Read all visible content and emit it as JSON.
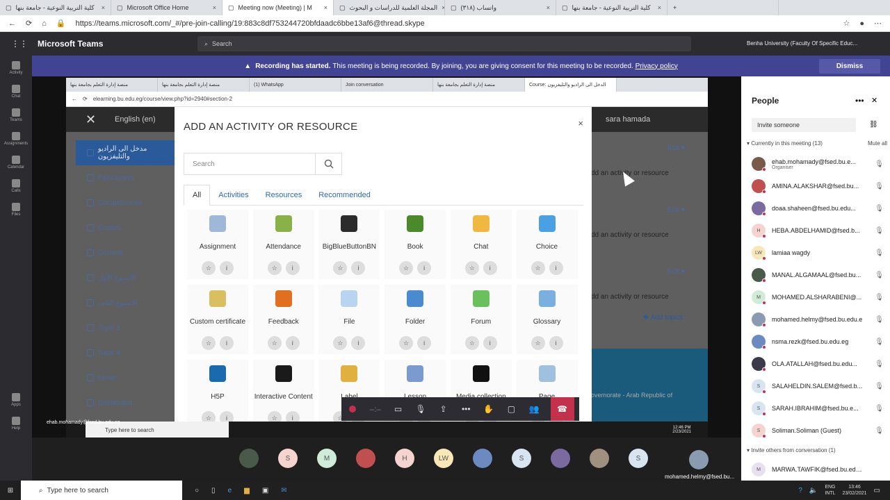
{
  "browser": {
    "tabs": [
      {
        "label": "كلية التربية النوعية - جامعة بنها",
        "active": false
      },
      {
        "label": "Microsoft Office Home",
        "active": false
      },
      {
        "label": "Meeting now (Meeting) | M",
        "active": true
      },
      {
        "label": "المجلة العلمية للدراسات و البحوث",
        "active": false
      },
      {
        "label": "(٣١٨) واتساب",
        "active": false
      },
      {
        "label": "كلية التربية النوعية - جامعة بنها",
        "active": false
      }
    ],
    "url": "https://teams.microsoft.com/_#/pre-join-calling/19:883c8df753244720bfdaadc6bbe13af6@thread.skype"
  },
  "teams": {
    "title": "Microsoft Teams",
    "search_placeholder": "Search",
    "org": "Benha University (Faculty Of Specific Educ...",
    "rail": [
      "Activity",
      "Chat",
      "Teams",
      "Assignments",
      "Calendar",
      "Calls",
      "Files",
      "Apps",
      "Help"
    ],
    "banner": {
      "bold": "Recording has started.",
      "text": "This meeting is being recorded. By joining, you are giving consent for this meeting to be recorded.",
      "link": "Privacy policy",
      "dismiss": "Dismiss"
    }
  },
  "shared": {
    "tabs": [
      "منصة إدارة التعلم بجامعة بنها",
      "منصة إدارة التعلم بجامعة بنها",
      "(1) WhatsApp",
      "Join conversation",
      "منصة إدارة التعلم بجامعة بنها",
      "Course: الدخل الى الراديو والتليفزيون"
    ],
    "url": "elearning.bu.edu.eg/course/view.php?id=2940#section-2",
    "lang": "English (en)",
    "user": "sara hamada",
    "sidebar": [
      "مدخل الى الراديو والتليفزيون",
      "Participants",
      "Competencies",
      "Grades",
      "General",
      "الأسبوع الأول",
      "الأسبوع الثاني",
      "Topic 3",
      "Topic 4",
      "Home",
      "Dashboard"
    ],
    "right_edit": [
      "Edit",
      "Edit",
      "Edit"
    ],
    "right_add": [
      "dd an activity or resource",
      "dd an activity or resource",
      "dd an activity or resource"
    ],
    "add_topics": "Add topics",
    "footer_text": "overnorate - Arab Republic of",
    "presenter_label": "ehab.mohamady@fsed.bu.edu.eg",
    "taskbar_search": "Type here to search",
    "clock_time": "12:46 PM",
    "clock_date": "2/23/2021"
  },
  "modal": {
    "title": "ADD AN ACTIVITY OR RESOURCE",
    "close": "×",
    "search_placeholder": "Search",
    "tabs": [
      "All",
      "Activities",
      "Resources",
      "Recommended"
    ],
    "items": [
      {
        "name": "Assignment",
        "color": "#a0b8d8"
      },
      {
        "name": "Attendance",
        "color": "#8ab04a"
      },
      {
        "name": "BigBlueButtonBN",
        "color": "#2b2b2b"
      },
      {
        "name": "Book",
        "color": "#4a8a2a"
      },
      {
        "name": "Chat",
        "color": "#f0b840"
      },
      {
        "name": "Choice",
        "color": "#4aa0e0"
      },
      {
        "name": "Custom certificate",
        "color": "#d8c060"
      },
      {
        "name": "Feedback",
        "color": "#e07020"
      },
      {
        "name": "File",
        "color": "#b8d4f0"
      },
      {
        "name": "Folder",
        "color": "#4a8ad0"
      },
      {
        "name": "Forum",
        "color": "#6ac05a"
      },
      {
        "name": "Glossary",
        "color": "#7ab0e0"
      },
      {
        "name": "H5P",
        "color": "#1a6ab0"
      },
      {
        "name": "Interactive Content",
        "color": "#1a1a1a"
      },
      {
        "name": "Label",
        "color": "#e0b040"
      },
      {
        "name": "Lesson",
        "color": "#7a9ad0"
      },
      {
        "name": "Media collection",
        "color": "#111111"
      },
      {
        "name": "Page",
        "color": "#a0c0e0"
      }
    ]
  },
  "people": {
    "title": "People",
    "invite_placeholder": "Invite someone",
    "current_header": "Currently in this meeting (13)",
    "mute_all": "Mute all",
    "participants": [
      {
        "name": "ehab.mohamady@fsed.bu.e...",
        "sub": "Organiser",
        "initials": "",
        "color": "#7a5a4a"
      },
      {
        "name": "AMINA.ALAKSHAR@fsed.bu...",
        "sub": "",
        "initials": "",
        "color": "#c05050"
      },
      {
        "name": "doaa.shaheen@fsed.bu.edu...",
        "sub": "",
        "initials": "",
        "color": "#7a6aa0"
      },
      {
        "name": "HEBA.ABDELHAMID@fsed.b...",
        "sub": "",
        "initials": "H",
        "color": "#f5d4d0"
      },
      {
        "name": "lamiaa wagdy",
        "sub": "",
        "initials": "LW",
        "color": "#f8e8b8"
      },
      {
        "name": "MANAL.ALGAMAAL@fsed.bu...",
        "sub": "",
        "initials": "",
        "color": "#4a5a4a"
      },
      {
        "name": "MOHAMED.ALSHARABENI@...",
        "sub": "",
        "initials": "M",
        "color": "#d0ecd8"
      },
      {
        "name": "mohamed.helmy@fsed.bu.edu.eg",
        "sub": "",
        "initials": "",
        "color": "#8a9ab0"
      },
      {
        "name": "nsma.rezk@fsed.bu.edu.eg",
        "sub": "",
        "initials": "",
        "color": "#6a8ac0"
      },
      {
        "name": "OLA.ATALLAH@fsed.bu.edu...",
        "sub": "",
        "initials": "",
        "color": "#3a3a4a"
      },
      {
        "name": "SALAHELDIN.SALEM@fsed.b...",
        "sub": "",
        "initials": "S",
        "color": "#d8e4f0"
      },
      {
        "name": "SARAH.IBRAHIM@fsed.bu.e...",
        "sub": "",
        "initials": "S",
        "color": "#d8e4f0"
      },
      {
        "name": "Soliman.Soliman (Guest)",
        "sub": "",
        "initials": "S",
        "color": "#f5d4d0"
      }
    ],
    "others_header": "Invite others from conversation (1)",
    "others": [
      {
        "name": "MARWA.TAWFIK@fsed.bu.edu.eg",
        "initials": "M",
        "color": "#e8e0f0"
      }
    ]
  },
  "gallery": {
    "items": [
      {
        "initials": "",
        "color": "#4a5a4a"
      },
      {
        "initials": "S",
        "color": "#f5d4d0"
      },
      {
        "initials": "M",
        "color": "#d0ecd8"
      },
      {
        "initials": "",
        "color": "#c05050"
      },
      {
        "initials": "H",
        "color": "#f5d4d0"
      },
      {
        "initials": "LW",
        "color": "#f8e8b8"
      },
      {
        "initials": "",
        "color": "#6a8ac0"
      },
      {
        "initials": "S",
        "color": "#d8e4f0"
      },
      {
        "initials": "",
        "color": "#7a6aa0"
      },
      {
        "initials": "",
        "color": "#a09080"
      },
      {
        "initials": "S",
        "color": "#d8e4f0"
      }
    ],
    "presenter_label": "mohamed.helmy@fsed.bu..."
  },
  "host_taskbar": {
    "search": "Type here to search",
    "lang": "ENG",
    "lang2": "INTL",
    "time": "13:46",
    "date": "23/02/2021"
  }
}
